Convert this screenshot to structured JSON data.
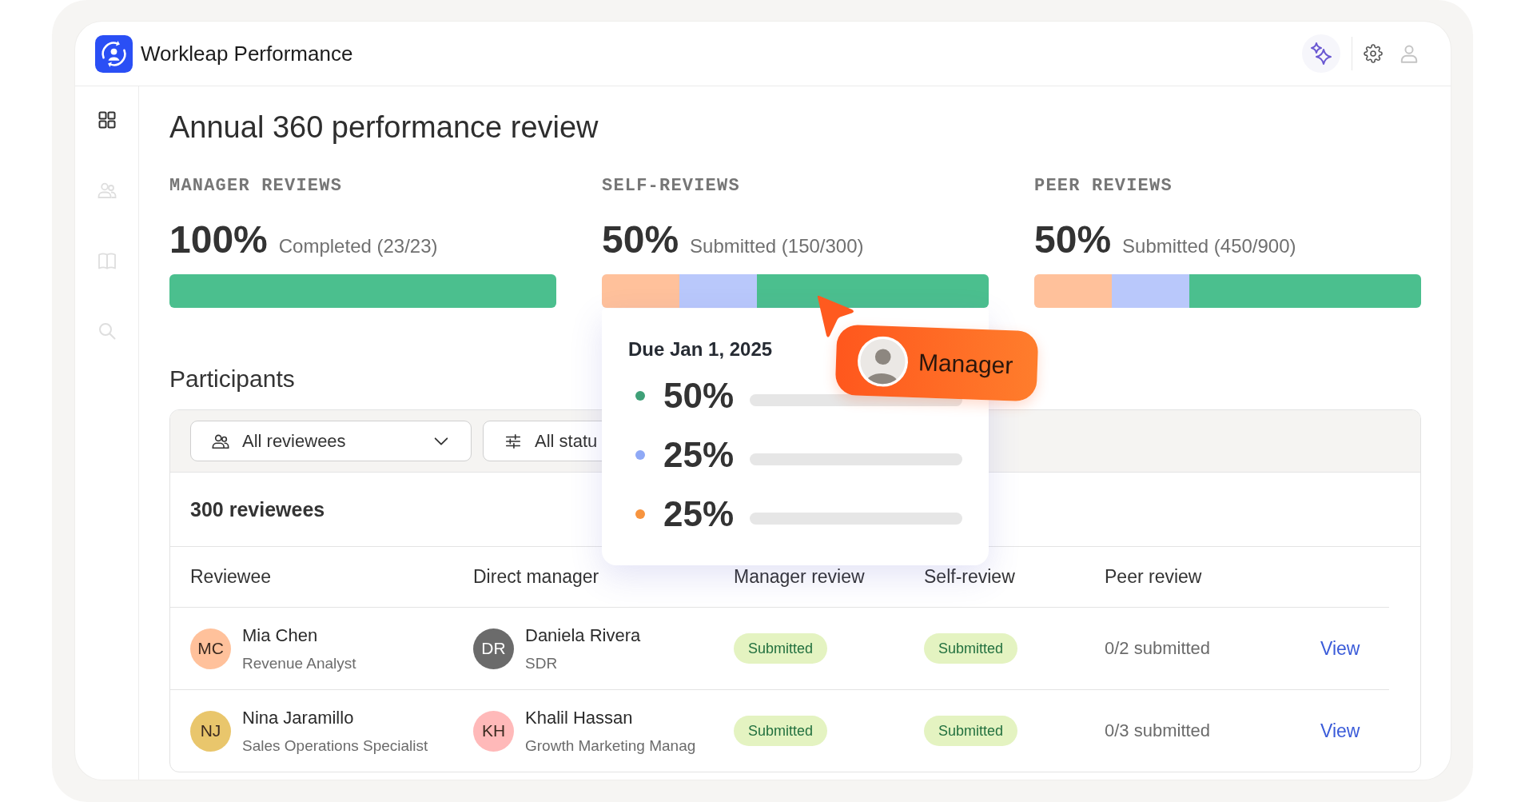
{
  "app": {
    "name": "Workleap Performance"
  },
  "sidebar": {
    "items": [
      {
        "selected": true
      },
      {
        "selected": false
      },
      {
        "selected": false
      },
      {
        "selected": false
      }
    ]
  },
  "page": {
    "title": "Annual 360 performance review"
  },
  "stats": [
    {
      "label": "MANAGER REVIEWS",
      "percent": "100%",
      "detail": "Completed (23/23)",
      "segments": [
        {
          "color": "#4bbf8e",
          "level": 1
        }
      ]
    },
    {
      "label": "SELF-REVIEWS",
      "percent": "50%",
      "detail": "Submitted (150/300)",
      "segments": [
        {
          "color": "#ffc19b",
          "level": 0.2
        },
        {
          "color": "#b9c8fb",
          "level": 0.2
        },
        {
          "color": "#4bbf8e",
          "level": 0.6
        }
      ],
      "popover": {
        "title": "Due Jan 1, 2025",
        "rows": [
          {
            "value": "50%",
            "color": "#3fa078"
          },
          {
            "value": "25%",
            "color": "#8fa9f6"
          },
          {
            "value": "25%",
            "color": "#f7943f"
          }
        ]
      },
      "cursor": {
        "label": "Manager"
      }
    },
    {
      "label": "PEER REVIEWS",
      "percent": "50%",
      "detail": "Submitted (450/900)",
      "segments": [
        {
          "color": "#ffc19b",
          "level": 0.2
        },
        {
          "color": "#b9c8fb",
          "level": 0.2
        },
        {
          "color": "#4bbf8e",
          "level": 0.6
        }
      ]
    }
  ],
  "participants": {
    "title": "Participants",
    "filters": [
      {
        "kind": "dropdown",
        "label": "All reviewees"
      },
      {
        "kind": "filter",
        "label": "All statu"
      }
    ],
    "count": "300 reviewees",
    "columns": [
      "Reviewee",
      "Direct manager",
      "Manager review",
      "Self-review",
      "Peer review"
    ],
    "rows": [
      {
        "reviewee": {
          "initials": "MC",
          "name": "Mia Chen",
          "title": "Revenue Analyst",
          "color": "#ffc19b"
        },
        "manager": {
          "initials": "DR",
          "name": "Daniela Rivera",
          "title": "SDR",
          "color": "#6b6b6b"
        },
        "manager_review": "Submitted",
        "self_review": "Submitted",
        "peer_review": "0/2 submitted",
        "action": "View"
      },
      {
        "reviewee": {
          "initials": "NJ",
          "name": "Nina Jaramillo",
          "title": "Sales Operations Specialist",
          "color": "#e9c66c"
        },
        "manager": {
          "initials": "KH",
          "name": "Khalil Hassan",
          "title": "Growth Marketing Manag",
          "color": "#ffb9b9"
        },
        "manager_review": "Submitted",
        "self_review": "Submitted",
        "peer_review": "0/3 submitted",
        "action": "View"
      }
    ]
  }
}
